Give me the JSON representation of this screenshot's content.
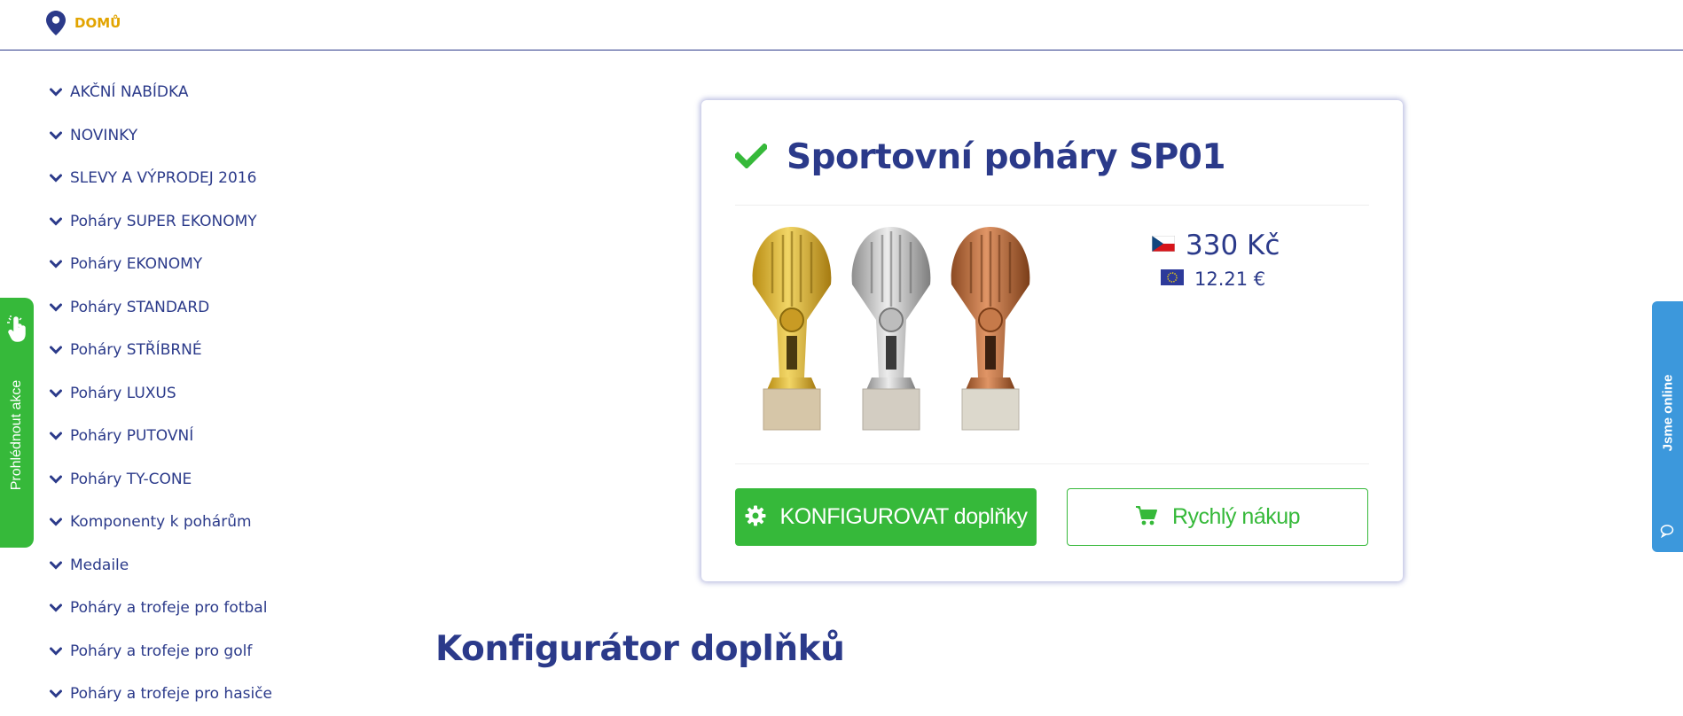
{
  "breadcrumb": {
    "home_label": "DOMŮ"
  },
  "sidebar": {
    "items": [
      {
        "label": "AKČNÍ NABÍDKA"
      },
      {
        "label": "NOVINKY"
      },
      {
        "label": "SLEVY A VÝPRODEJ 2016"
      },
      {
        "label": "Poháry SUPER EKONOMY"
      },
      {
        "label": "Poháry EKONOMY"
      },
      {
        "label": "Poháry STANDARD"
      },
      {
        "label": "Poháry STŘÍBRNÉ"
      },
      {
        "label": "Poháry LUXUS"
      },
      {
        "label": "Poháry PUTOVNÍ"
      },
      {
        "label": "Poháry TY-CONE"
      },
      {
        "label": "Komponenty k pohárům"
      },
      {
        "label": "Medaile"
      },
      {
        "label": "Poháry a trofeje pro fotbal"
      },
      {
        "label": "Poháry a trofeje pro golf"
      },
      {
        "label": "Poháry a trofeje pro hasiče"
      }
    ]
  },
  "left_tab": {
    "label": "Prohlédnout akce"
  },
  "right_tab": {
    "label": "Jsme online"
  },
  "product": {
    "title": "Sportovní poháry SP01",
    "price_czk": "330 Kč",
    "price_eur": "12.21 €",
    "configure_button": "KONFIGUROVAT doplňky",
    "quick_buy_button": "Rychlý nákup"
  },
  "configurator": {
    "heading": "Konfigurátor doplňků"
  },
  "colors": {
    "navy": "#2b3a8a",
    "green": "#36b93a",
    "gold_link": "#e2a400",
    "blue_tab": "#3c98dc"
  },
  "icons": {
    "breadcrumb": "map-pin-icon",
    "sidebar": "chevron-down-icon",
    "title": "check-icon",
    "configure": "gear-icon",
    "quick_buy": "cart-icon",
    "left_tab": "hand-pointer-icon",
    "right_tab": "chat-icon",
    "price_czk": "czech-flag-icon",
    "price_eur": "eu-flag-icon"
  }
}
